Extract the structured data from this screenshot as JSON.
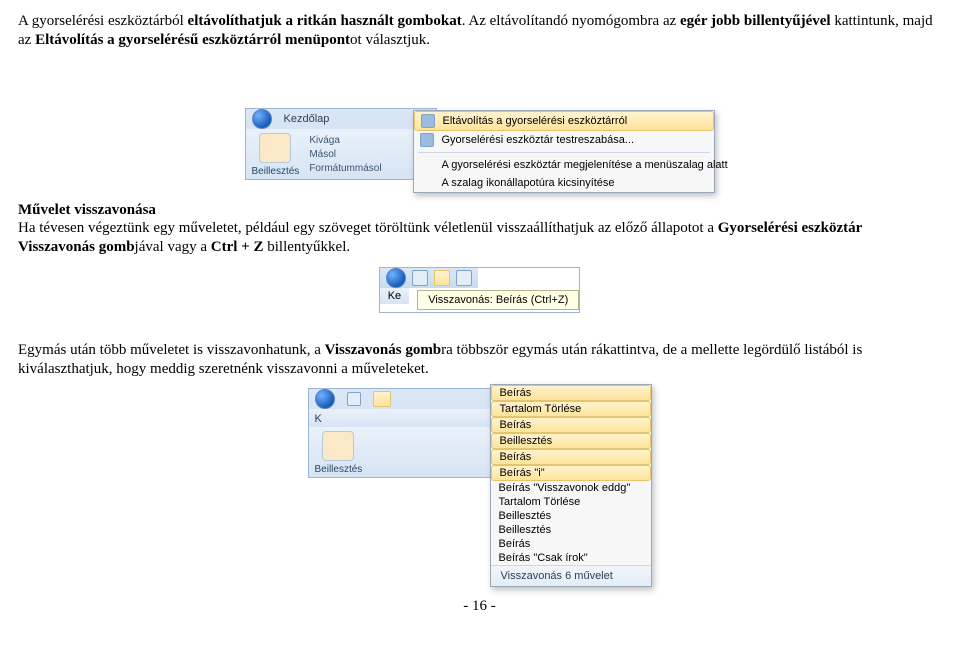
{
  "para1": {
    "t1": "A gyorselérési eszköztárból ",
    "b1": "eltávolíthatjuk a ritkán használt gombokat",
    "t2": ". Az eltávolítandó nyomógombra az ",
    "b2": "egér jobb billentyűjével",
    "t3": " kattintunk, majd az ",
    "b3": "Eltávolítás a gyorselérésű eszköztárról menüpont",
    "t4": "ot választjuk."
  },
  "img1": {
    "tab": "Kezdőlap",
    "grp_paste": "Beillesztés",
    "sm_cut": "Kivága",
    "sm_copy": "Másol",
    "grp_label": "Formátummásol",
    "menu": {
      "i1": "Eltávolítás a gyorselérési eszköztárról",
      "i2": "Gyorselérési eszköztár testreszabása...",
      "i3": "A gyorselérési eszköztár megjelenítése a menüszalag alatt",
      "i4": "A szalag ikonállapotúra kicsinyítése"
    }
  },
  "section2": {
    "title": "Művelet visszavonása",
    "t1": "Ha tévesen végeztünk egy műveletet, például egy szöveget töröltünk véletlenül visszaállíthatjuk az előző állapotot a ",
    "b1": "Gyorselérési eszköztár Visszavonás gomb",
    "t2": "jával vagy a ",
    "b2": "Ctrl + Z",
    "t3": " billentyűkkel."
  },
  "img2": {
    "tab_short": "Ke",
    "tooltip": "Visszavonás: Beírás (Ctrl+Z)"
  },
  "para3": {
    "t1": "Egymás után több műveletet is visszavonhatunk, a ",
    "b1": "Visszavonás gomb",
    "t2": "ra többször egymás után rákattintva, de a mellette legördülő listából is kiválaszthatjuk, hogy meddig szeretnénk visszavonni a műveleteket."
  },
  "img3": {
    "tab_short": "K",
    "grp_paste": "Beillesztés",
    "items": [
      "Beírás",
      "Tartalom Törlése",
      "Beírás",
      "Beillesztés",
      "Beírás",
      "Beírás \"i\"",
      "Beírás \"Visszavonok eddg\"",
      "Tartalom Törlése",
      "Beillesztés",
      "Beillesztés",
      "Beírás",
      "Beírás \"Csak írok\""
    ],
    "footer": "Visszavonás 6 művelet",
    "hilite_upto": 6
  },
  "page": "- 16 -"
}
